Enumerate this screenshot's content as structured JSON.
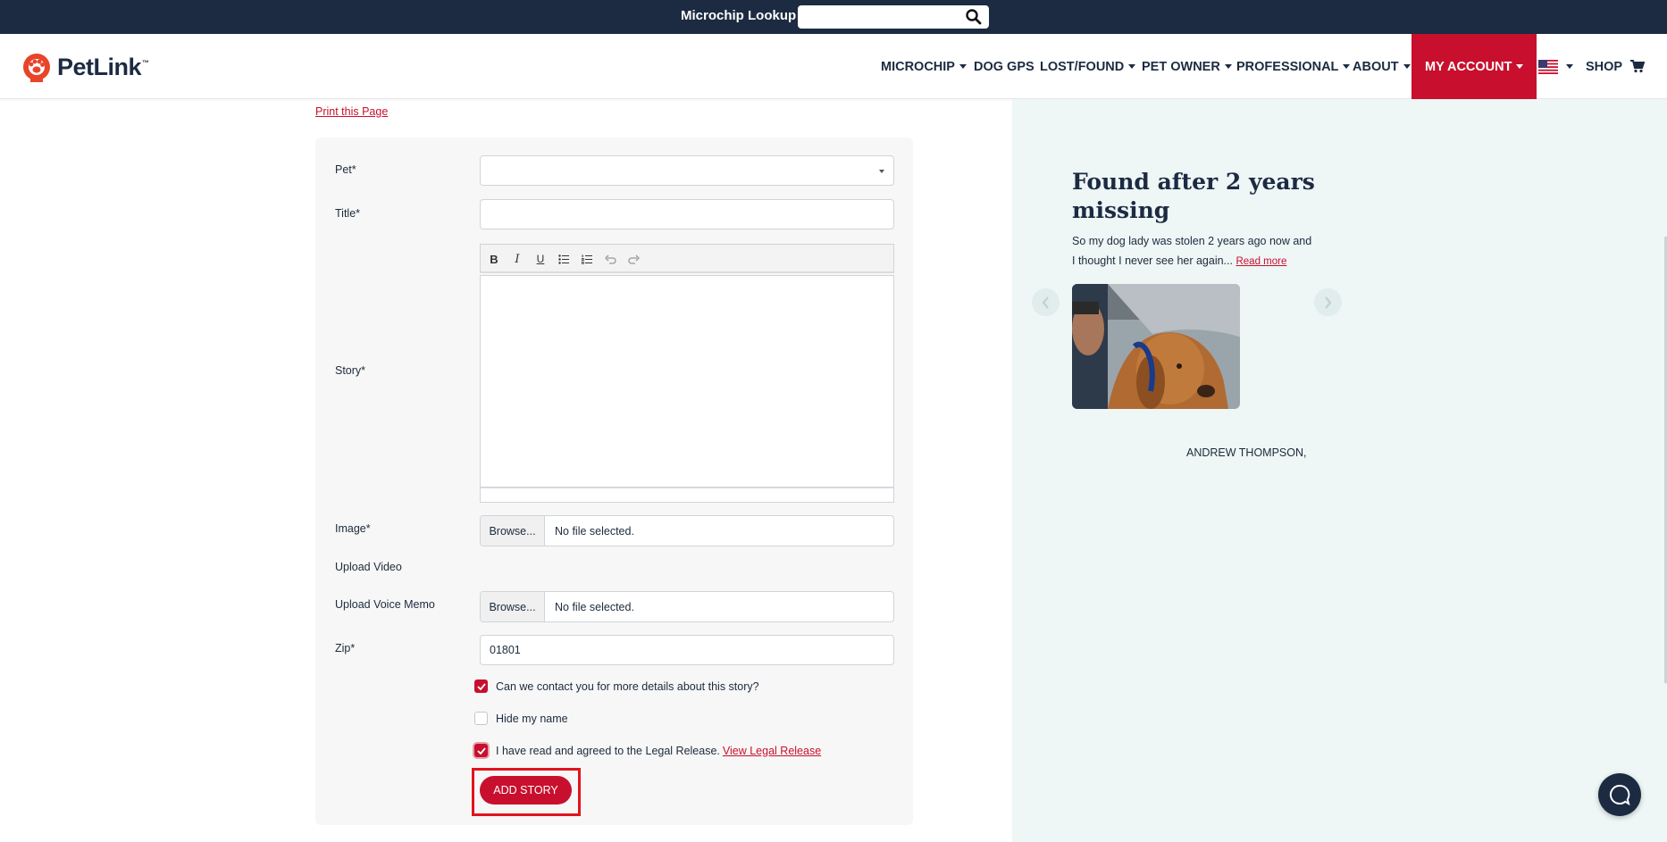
{
  "topbar": {
    "lookup_label": "Microchip Lookup",
    "search_placeholder": ""
  },
  "brand": {
    "name": "PetLink",
    "trademark": "™"
  },
  "nav": {
    "microchip": "MICROCHIP",
    "dog_gps": "DOG GPS",
    "lost_found": "LOST/FOUND",
    "pet_owner": "PET OWNER",
    "professional": "PROFESSIONAL",
    "about": "ABOUT",
    "my_account": "MY ACCOUNT",
    "shop": "SHOP"
  },
  "page": {
    "print_link": "Print this Page"
  },
  "form": {
    "pet_label": "Pet*",
    "pet_value": "",
    "title_label": "Title*",
    "title_value": "",
    "story_label": "Story*",
    "image_label": "Image*",
    "browse_label": "Browse...",
    "no_file": "No file selected.",
    "upload_video_label": "Upload Video",
    "upload_voice_label": "Upload Voice Memo",
    "zip_label": "Zip*",
    "zip_value": "01801",
    "contact_label": "Can we contact you for more details about this story?",
    "contact_checked": true,
    "hide_name_label": "Hide my name",
    "hide_name_checked": false,
    "legal_label": "I have read and agreed to the Legal Release.",
    "legal_link": "View Legal Release",
    "legal_checked": true,
    "submit_label": "ADD STORY"
  },
  "story_card": {
    "title": "Found after 2 years missing",
    "text": "So my dog lady was stolen 2 years ago now and I thought I never see her again...",
    "read_more": "Read more",
    "author": "ANDREW THOMPSON,"
  },
  "colors": {
    "brand_red": "#c8102e",
    "navy": "#1c2b42",
    "panel_bg": "#eef6f6"
  }
}
